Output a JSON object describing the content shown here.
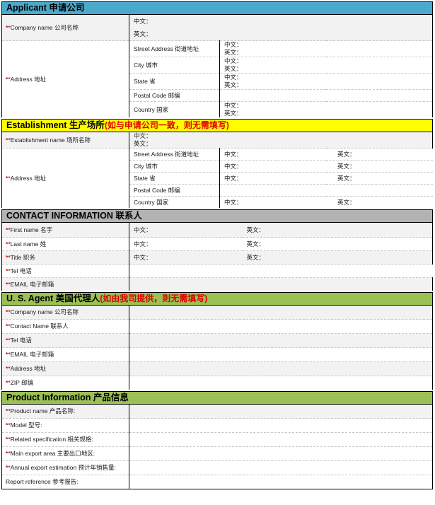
{
  "document": {
    "title": "FDA Registration Application Form",
    "colors": {
      "applicant_header": "#4ba9cc",
      "establishment_header": "#ffff00",
      "contact_header": "#b3b3b3",
      "agent_header": "#9bc054",
      "product_header": "#9bc054",
      "required_star": "#e00000",
      "note_text": "#e00000",
      "row_shade": "#f2f2f2"
    },
    "labels": {
      "chinese_prefix": "中文：",
      "english_prefix": "英文："
    }
  },
  "sections": [
    {
      "id": "applicant",
      "header": {
        "en": "Applicant ",
        "cn": "申请公司",
        "note": ""
      },
      "rows": [
        {
          "label_en": "*Company name ",
          "label_cn": "公司名称",
          "required": true,
          "type": "stacked",
          "zh": "中文：",
          "en": "英文："
        },
        {
          "label_en": "*Address ",
          "label_cn": "地址",
          "required": true,
          "type": "address",
          "sub_rows": [
            {
              "sub_en": "Street Address ",
              "sub_cn": "街道地址",
              "zh": "中文：",
              "en": "英文："
            },
            {
              "sub_en": "City ",
              "sub_cn": "城市",
              "zh": "中文：",
              "en": "英文："
            },
            {
              "sub_en": "State ",
              "sub_cn": "省",
              "zh": "中文：",
              "en": "英文："
            },
            {
              "sub_en": "Postal Code ",
              "sub_cn": "邮编",
              "zh": "",
              "en": ""
            },
            {
              "sub_en": "Country ",
              "sub_cn": "国家",
              "zh": "中文：",
              "en": "英文："
            }
          ]
        }
      ]
    },
    {
      "id": "establishment",
      "header": {
        "en": "Establishment ",
        "cn": "生产场所",
        "note": "(如与申请公司一致，则无需填写)"
      },
      "rows": [
        {
          "label_en": "*Establishment name ",
          "label_cn": "场所名称",
          "required": true,
          "type": "stacked",
          "zh": "中文：",
          "en": "英文："
        },
        {
          "label_en": "*Address ",
          "label_cn": "地址",
          "required": true,
          "type": "address_inline",
          "sub_rows": [
            {
              "sub_en": "Street Address ",
              "sub_cn": "街道地址",
              "zh": "中文：",
              "en": "英文："
            },
            {
              "sub_en": "City ",
              "sub_cn": "城市",
              "zh": "中文：",
              "en": "英文："
            },
            {
              "sub_en": "State ",
              "sub_cn": "省",
              "zh": "中文：",
              "en": "英文："
            },
            {
              "sub_en": "Postal Code ",
              "sub_cn": "邮编",
              "zh": "",
              "en": ""
            },
            {
              "sub_en": "Country ",
              "sub_cn": "国家",
              "zh": "中文：",
              "en": "英文："
            }
          ]
        }
      ]
    },
    {
      "id": "contact",
      "header": {
        "en": "CONTACT INFORMATION ",
        "cn": "联系人",
        "note": ""
      },
      "rows": [
        {
          "label_en": "*First name ",
          "label_cn": "名字",
          "required": true,
          "type": "dual",
          "zh": "中文：",
          "en": "英文："
        },
        {
          "label_en": "*Last name ",
          "label_cn": "姓",
          "required": true,
          "type": "dual",
          "zh": "中文：",
          "en": "英文："
        },
        {
          "label_en": "*Title ",
          "label_cn": "职务",
          "required": true,
          "type": "dual",
          "zh": "中文：",
          "en": "英文："
        },
        {
          "label_en": "*Tel ",
          "label_cn": "电话",
          "required": true,
          "type": "blank",
          "zh": "",
          "en": ""
        },
        {
          "label_en": "*EMAIL ",
          "label_cn": "电子邮箱",
          "required": true,
          "type": "blank",
          "zh": "",
          "en": ""
        }
      ]
    },
    {
      "id": "us_agent",
      "header": {
        "en": "U. S. Agent ",
        "cn": "美国代理人",
        "note": "(如由我司提供，则无需填写)"
      },
      "rows": [
        {
          "label_en": "*Company name ",
          "label_cn": "公司名称",
          "required": true,
          "type": "blank"
        },
        {
          "label_en": "*Contact Name ",
          "label_cn": "联系人",
          "required": true,
          "type": "blank"
        },
        {
          "label_en": "*Tel ",
          "label_cn": "电话",
          "required": true,
          "type": "blank"
        },
        {
          "label_en": "*EMAIL ",
          "label_cn": "电子邮箱",
          "required": true,
          "type": "blank"
        },
        {
          "label_en": "*Address ",
          "label_cn": "地址",
          "required": true,
          "type": "blank"
        },
        {
          "label_en": "*ZIP ",
          "label_cn": "邮编",
          "required": true,
          "type": "blank"
        }
      ]
    },
    {
      "id": "product",
      "header": {
        "en": "Product Information ",
        "cn": "产品信息",
        "note": ""
      },
      "rows": [
        {
          "label_en": "*Product name ",
          "label_cn": "产品名称:",
          "required": true,
          "type": "blank"
        },
        {
          "label_en": "*Model ",
          "label_cn": "型号:",
          "required": true,
          "type": "blank"
        },
        {
          "label_en": "*Related specification ",
          "label_cn": "相关规格:",
          "required": true,
          "type": "blank"
        },
        {
          "label_en": "*Main export area ",
          "label_cn": "主要出口地区:",
          "required": true,
          "type": "blank"
        },
        {
          "label_en": "*Annual export estimation ",
          "label_cn": "预计年销售量:",
          "required": true,
          "type": "blank"
        },
        {
          "label_en": " Report reference ",
          "label_cn": "参考报告:",
          "required": false,
          "type": "blank"
        }
      ]
    }
  ]
}
